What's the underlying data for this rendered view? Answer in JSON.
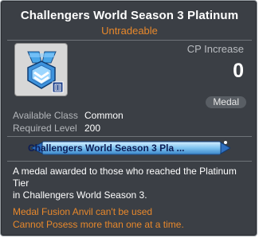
{
  "item": {
    "name": "Challengers World Season 3 Platinum",
    "trade_status": "Untradeable",
    "icon": "platinum-medal-icon",
    "cp_label": "CP Increase",
    "cp_value": "0",
    "type_badge": "Medal",
    "requirements": [
      {
        "label": "Available Class",
        "value": "Common"
      },
      {
        "label": "Required Level",
        "value": "200"
      }
    ],
    "medal_preview_text": "Challengers World Season 3 Pla ...",
    "description_lines": [
      "A medal awarded to those who reached the Platinum",
      "Tier",
      "in Challengers World Season 3."
    ],
    "warnings": [
      "Medal Fusion Anvil can't be used",
      "Cannot Posess more than one at a time."
    ]
  },
  "colors": {
    "background": "#3b3f45",
    "title": "#ffffff",
    "accent_orange": "#e8882b",
    "muted_label": "#b3b6ba"
  }
}
